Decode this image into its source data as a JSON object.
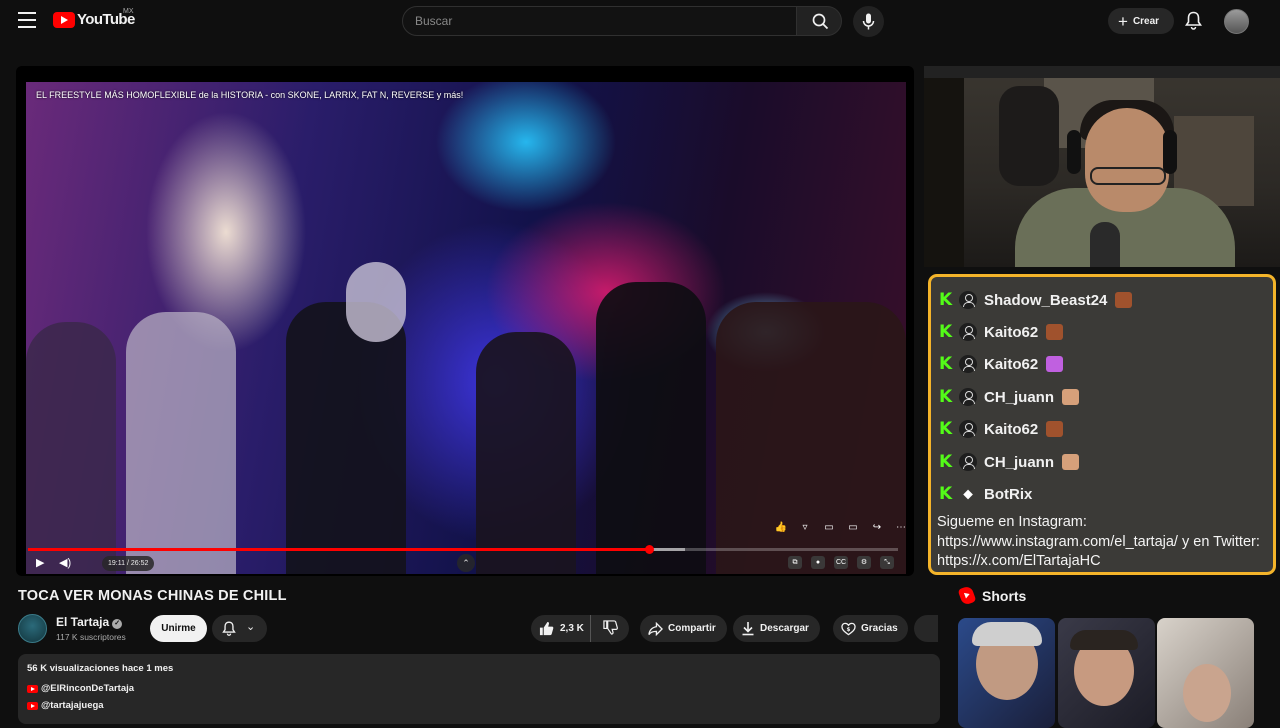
{
  "header": {
    "logo_text": "YouTube",
    "region": "MX",
    "search_placeholder": "Buscar",
    "create_label": "Crear"
  },
  "player": {
    "overlay_title": "EL FREESTYLE MÁS HOMOFLEXIBLE de la HISTORIA - con SKONE, LARRIX, FAT N, REVERSE y más!",
    "time": "19:11 / 26:52",
    "progress_fraction": 0.714,
    "buffered_fraction": 0.755
  },
  "video": {
    "title": "TOCA VER MONAS CHINAS DE CHILL",
    "channel_name": "El Tartaja",
    "subscribers": "117 K suscriptores",
    "join_label": "Unirme",
    "likes": "2,3 K",
    "share_label": "Compartir",
    "download_label": "Descargar",
    "thanks_label": "Gracias"
  },
  "description": {
    "meta": "56 K visualizaciones  hace 1 mes",
    "links": [
      "@ElRinconDeTartaja",
      "@tartajajuega"
    ]
  },
  "chat": {
    "messages": [
      {
        "user": "Shadow_Beast24",
        "badge": "user",
        "emote_color": "#a0522d"
      },
      {
        "user": "Kaito62",
        "badge": "user",
        "emote_color": "#a0522d"
      },
      {
        "user": "Kaito62",
        "badge": "user",
        "emote_color": "#c060e0"
      },
      {
        "user": "CH_juann",
        "badge": "user",
        "emote_color": "#d6a07a"
      },
      {
        "user": "Kaito62",
        "badge": "user",
        "emote_color": "#a0522d"
      },
      {
        "user": "CH_juann",
        "badge": "user",
        "emote_color": "#d6a07a"
      },
      {
        "user": "BotRix",
        "badge": "bot",
        "emote_color": ""
      }
    ],
    "bot_message": "Sigueme en Instagram: https://www.instagram.com/el_tartaja/ y en Twitter: https://x.com/ElTartajaHC",
    "accent_color": "#f4b42a",
    "platform_color": "#53fc18"
  },
  "shorts": {
    "heading": "Shorts"
  },
  "icons": [
    "menu-icon",
    "search-icon",
    "mic-icon",
    "bell-icon",
    "like-icon",
    "dislike-icon",
    "share-icon",
    "download-icon",
    "heart-icon",
    "play-icon",
    "volume-icon"
  ]
}
